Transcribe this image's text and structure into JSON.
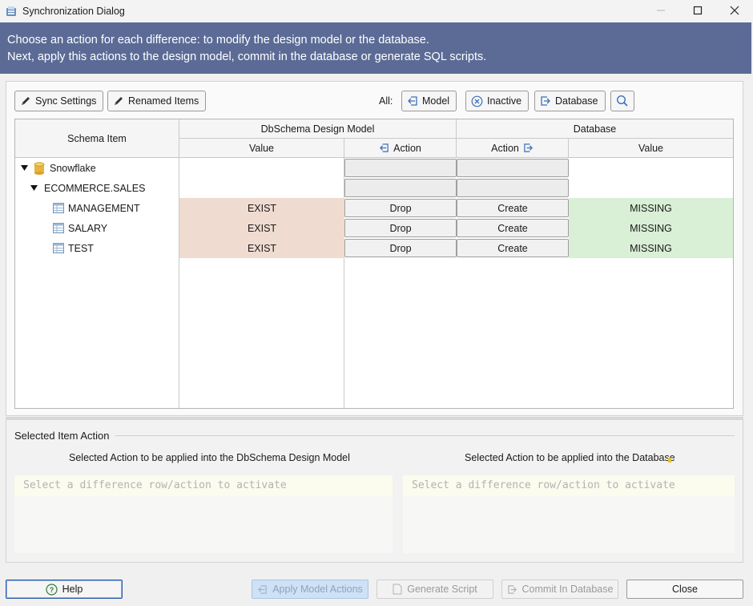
{
  "window": {
    "title": "Synchronization Dialog"
  },
  "banner": {
    "line1": "Choose an action for each difference: to modify the design model or the database.",
    "line2": "Next, apply this actions to the design model, commit in the database or generate SQL scripts."
  },
  "toolbar": {
    "sync_settings": "Sync Settings",
    "renamed_items": "Renamed Items",
    "all_label": "All:",
    "model": "Model",
    "inactive": "Inactive",
    "database": "Database"
  },
  "grid": {
    "headers": {
      "schema_item": "Schema Item",
      "design_model": "DbSchema Design Model",
      "database": "Database",
      "value_left": "Value",
      "action_left": "Action",
      "action_right": "Action",
      "value_right": "Value"
    },
    "rows": [
      {
        "label": "Snowflake",
        "level": 0,
        "icon": "database-icon"
      },
      {
        "label": "ECOMMERCE.SALES",
        "level": 1,
        "icon": "none"
      },
      {
        "label": "MANAGEMENT",
        "level": 2,
        "icon": "table-icon",
        "model_value": "EXIST",
        "model_action": "Drop",
        "db_action": "Create",
        "db_value": "MISSING"
      },
      {
        "label": "SALARY",
        "level": 2,
        "icon": "table-icon",
        "model_value": "EXIST",
        "model_action": "Drop",
        "db_action": "Create",
        "db_value": "MISSING"
      },
      {
        "label": "TEST",
        "level": 2,
        "icon": "table-icon",
        "model_value": "EXIST",
        "model_action": "Drop",
        "db_action": "Create",
        "db_value": "MISSING"
      }
    ]
  },
  "selected": {
    "title": "Selected Item Action",
    "model_label": "Selected Action to be applied into the DbSchema Design Model",
    "db_label": "Selected Action to be applied into the Database",
    "model_placeholder": "Select a difference row/action to activate",
    "db_placeholder": "Select a difference row/action to activate"
  },
  "footer": {
    "help": "Help",
    "apply_model": "Apply Model Actions",
    "generate_script": "Generate Script",
    "commit": "Commit In Database",
    "close": "Close"
  },
  "colors": {
    "banner": "#5b6b96",
    "exist_cell": "#f0dbd1",
    "missing_cell": "#d9efd6",
    "accent_blue": "#3a6fb8"
  }
}
